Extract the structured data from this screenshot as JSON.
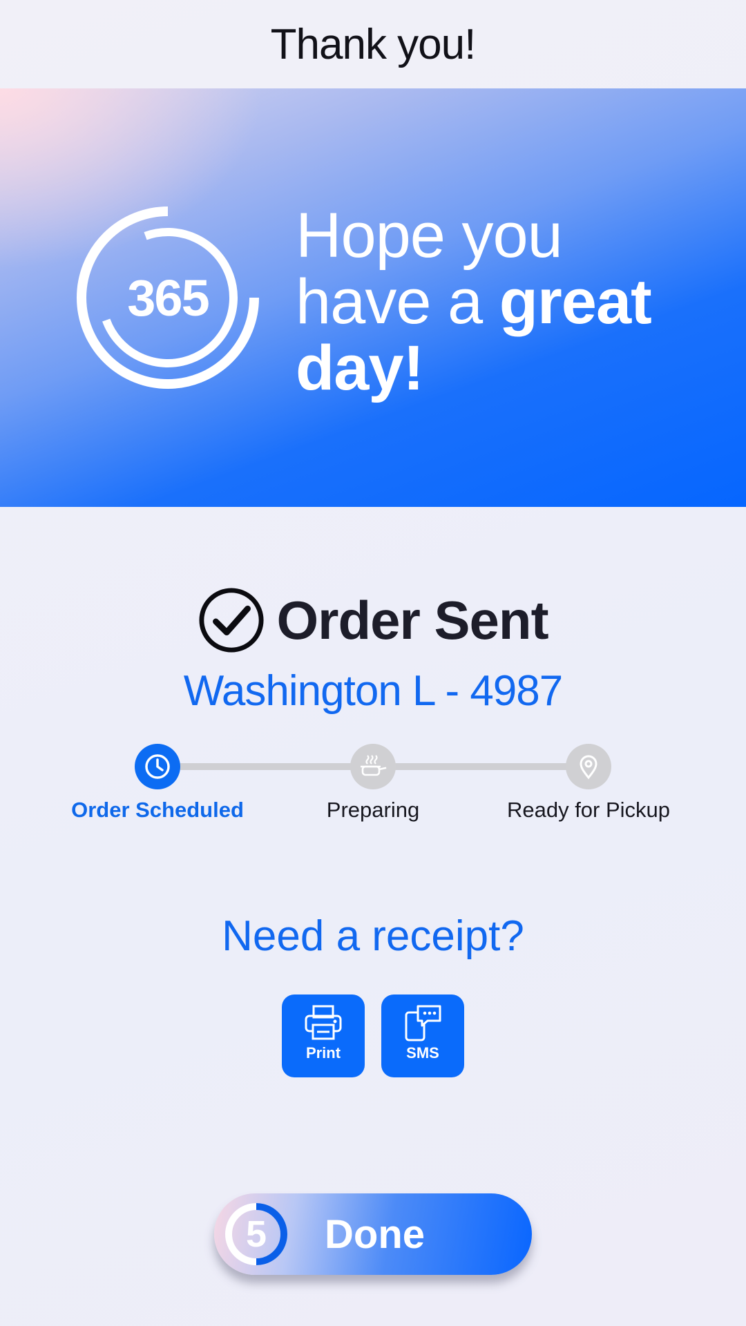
{
  "header": {
    "title": "Thank you!"
  },
  "hero": {
    "logo_text": "365",
    "message_line1": "Hope you",
    "message_line2_light": "have a ",
    "message_line2_bold": "great",
    "message_line3_bold": "day!"
  },
  "order": {
    "status_title": "Order Sent",
    "name": "Washington L - 4987",
    "steps": [
      {
        "label": "Order Scheduled",
        "icon": "clock-icon",
        "state": "active"
      },
      {
        "label": "Preparing",
        "icon": "cooking-pot-icon",
        "state": "inactive"
      },
      {
        "label": "Ready for Pickup",
        "icon": "location-pin-icon",
        "state": "inactive"
      }
    ]
  },
  "receipt": {
    "question": "Need a receipt?",
    "print_label": "Print",
    "sms_label": "SMS"
  },
  "done": {
    "countdown": "5",
    "label": "Done"
  },
  "colors": {
    "accent": "#0a6bfb",
    "text_dark": "#1d1d2a",
    "inactive": "#d0d0d3"
  }
}
